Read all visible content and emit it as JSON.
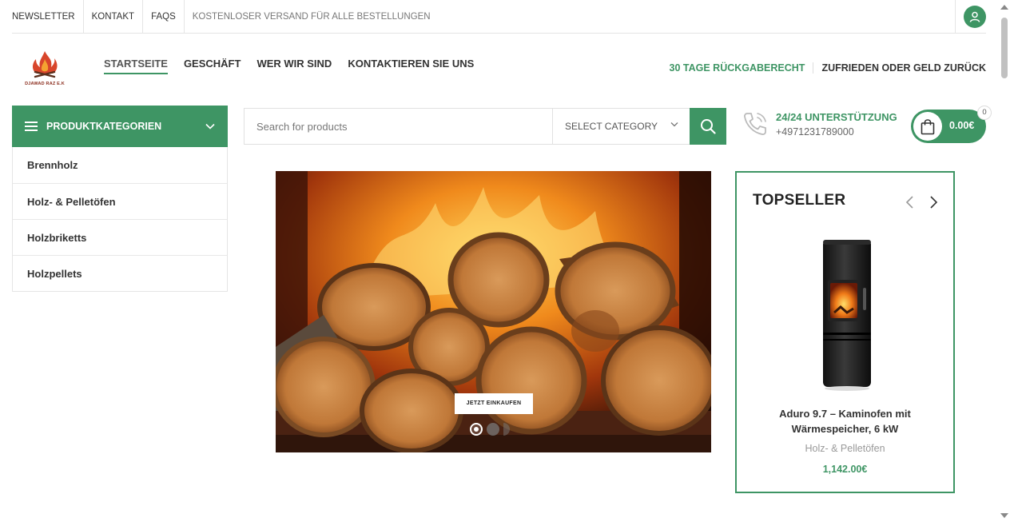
{
  "topbar": {
    "links": [
      "NEWSLETTER",
      "KONTAKT",
      "FAQS"
    ],
    "note": "KOSTENLOSER VERSAND FÜR ALLE BESTELLUNGEN"
  },
  "header": {
    "logo_text": "DJAWAD RAZ E.K",
    "nav": [
      "STARTSEITE",
      "GESCHÄFT",
      "WER WIR SIND",
      "KONTAKTIEREN SIE UNS"
    ],
    "right_links": [
      "30 TAGE RÜCKGABERECHT",
      "ZUFRIEDEN ODER GELD ZURÜCK"
    ]
  },
  "categories": {
    "title": "PRODUKTKATEGORIEN",
    "items": [
      "Brennholz",
      "Holz- & Pelletöfen",
      "Holzbriketts",
      "Holzpellets"
    ]
  },
  "search": {
    "placeholder": "Search for products",
    "category": "SELECT CATEGORY"
  },
  "support": {
    "title": "24/24 UNTERSTÜTZUNG",
    "phone": "+4971231789000"
  },
  "cart": {
    "amount": "0.00€",
    "count": "0"
  },
  "hero": {
    "cta": "JETZT EINKAUFEN",
    "slides": 3,
    "active_slide": 1
  },
  "topseller": {
    "title": "TOPSELLER",
    "product_name": "Aduro 9.7 – Kaminofen mit Wärmespeicher, 6 kW",
    "product_category": "Holz- & Pelletöfen",
    "price": "1,142.00€"
  },
  "colors": {
    "accent": "#3e9564",
    "logo": "#8b2c1c"
  }
}
